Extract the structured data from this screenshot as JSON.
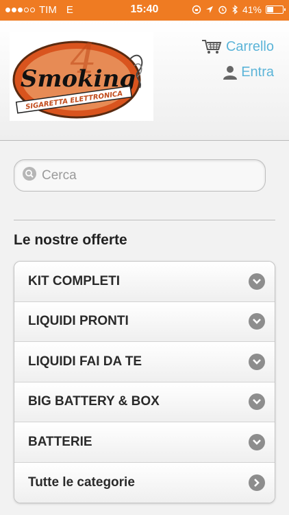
{
  "status_bar": {
    "carrier": "TIM",
    "network": "E",
    "time": "15:40",
    "battery": "41%",
    "battery_level": 0.41
  },
  "header": {
    "logo": {
      "brand": "Smoking",
      "tagline": "SIGARETTA ELETTRONICA"
    },
    "cart_label": "Carrello",
    "login_label": "Entra"
  },
  "search": {
    "placeholder": "Cerca"
  },
  "offers": {
    "title": "Le nostre offerte",
    "items": [
      {
        "label": "KIT COMPLETI",
        "icon": "chevron-down-icon"
      },
      {
        "label": "LIQUIDI PRONTI",
        "icon": "chevron-down-icon"
      },
      {
        "label": "LIQUIDI FAI DA TE",
        "icon": "chevron-down-icon"
      },
      {
        "label": "BIG BATTERY & BOX",
        "icon": "chevron-down-icon"
      },
      {
        "label": "BATTERIE",
        "icon": "chevron-down-icon"
      },
      {
        "label": "Tutte le categorie",
        "icon": "chevron-right-icon"
      }
    ]
  },
  "colors": {
    "status_bar": "#ef7b22",
    "link": "#5bb4d8",
    "logo_orange": "#d9541e"
  }
}
